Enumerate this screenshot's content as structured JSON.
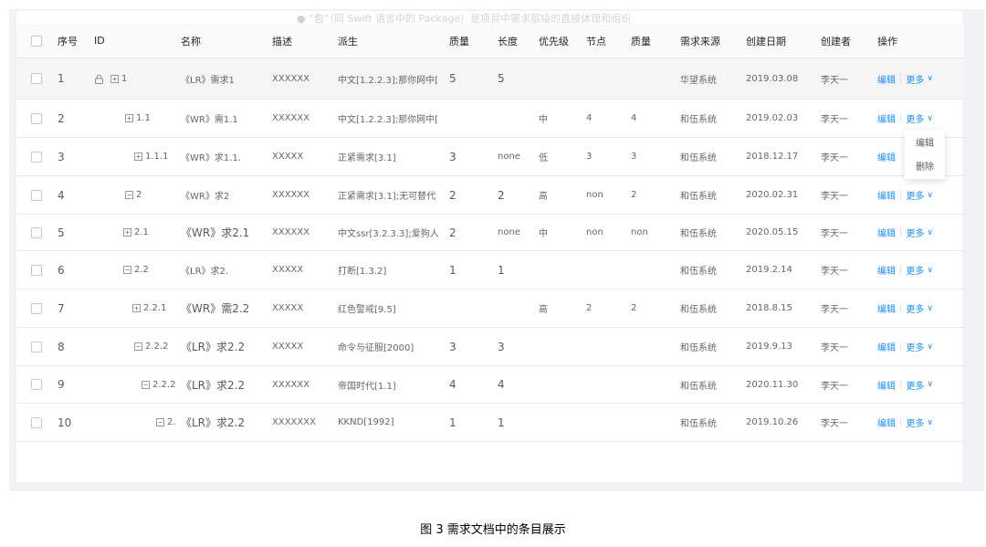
{
  "ghost_text": "● “包”（同 Swift 语言中的 Package）是项目中需求层级的直接体现和组织",
  "headers": [
    "序号",
    "ID",
    "名称",
    "描述",
    "派生",
    "质量",
    "长度",
    "优先级",
    "节点",
    "质量",
    "需求来源",
    "创建日期",
    "创建者",
    "操作"
  ],
  "rows": [
    {
      "seq": "1",
      "locked": true,
      "tree": "plus",
      "id": "1",
      "name": "《LR》需求1",
      "desc": "XXXXXX",
      "derive": "中文[1.2.2.3];那你网中[",
      "quality": "5",
      "length": "5",
      "priority": "",
      "node": "",
      "quality2": "",
      "source": "华望系统",
      "date": "2019.03.08",
      "creator": "李天一",
      "more": true
    },
    {
      "seq": "2",
      "locked": false,
      "tree": "plus",
      "id": "1.1",
      "name": "《WR》需1.1",
      "desc": "XXXXXX",
      "derive": "中文[1.2.2.3];那你网中[",
      "quality": "",
      "length": "",
      "priority": "中",
      "node": "4",
      "quality2": "4",
      "source": "和伍系统",
      "date": "2019.02.03",
      "creator": "李天一",
      "more": true
    },
    {
      "seq": "3",
      "locked": false,
      "tree": "plus",
      "id": "1.1.1",
      "name": "《WR》求1.1.",
      "desc": "XXXXX",
      "derive": "正紧需求[3.1]",
      "quality": "3",
      "length": "none",
      "priority": "低",
      "node": "3",
      "quality2": "3",
      "source": "和伍系统",
      "date": "2018.12.17",
      "creator": "李天一",
      "more": false
    },
    {
      "seq": "4",
      "locked": false,
      "tree": "minus",
      "id": "2",
      "name": "《WR》求2",
      "desc": "XXXXXX",
      "derive": "正紧需求[3.1];无可替代",
      "quality": "2",
      "length": "2",
      "priority": "高",
      "node": "non",
      "quality2": "2",
      "source": "和伍系统",
      "date": "2020.02.31",
      "creator": "李天一",
      "more": true
    },
    {
      "seq": "5",
      "locked": false,
      "tree": "plus",
      "id": "2.1",
      "name": "《WR》求2.1",
      "desc": "XXXXXX",
      "derive": "中文ssr[3.2.3.3];爱狗人",
      "quality": "2",
      "length": "none",
      "priority": "中",
      "node": "non",
      "quality2": "non",
      "source": "和伍系统",
      "date": "2020.05.15",
      "creator": "李天一",
      "more": true
    },
    {
      "seq": "6",
      "locked": false,
      "tree": "minus",
      "id": "2.2",
      "name": "《LR》求2.",
      "desc": "XXXXX",
      "derive": "打断[1.3.2]",
      "quality": "1",
      "length": "1",
      "priority": "",
      "node": "",
      "quality2": "",
      "source": "和伍系统",
      "date": "2019.2.14",
      "creator": "李天一",
      "more": true
    },
    {
      "seq": "7",
      "locked": false,
      "tree": "plus",
      "id": "2.2.1",
      "name": "《WR》需2.2",
      "desc": "XXXXX",
      "derive": "红色警戒[9.5]",
      "quality": "",
      "length": "",
      "priority": "高",
      "node": "2",
      "quality2": "2",
      "source": "和伍系统",
      "date": "2018.8.15",
      "creator": "李天一",
      "more": true
    },
    {
      "seq": "8",
      "locked": false,
      "tree": "minus",
      "id": "2.2.2",
      "name": "《LR》求2.2",
      "desc": "XXXXX",
      "derive": "命令与征服[2000]",
      "quality": "3",
      "length": "3",
      "priority": "",
      "node": "",
      "quality2": "",
      "source": "和伍系统",
      "date": "2019.9.13",
      "creator": "李天一",
      "more": true
    },
    {
      "seq": "9",
      "locked": false,
      "tree": "minus",
      "id": "2.2.2",
      "name": "《LR》求2.2",
      "desc": "XXXXXX",
      "derive": "帝国时代[1.1]",
      "quality": "4",
      "length": "4",
      "priority": "",
      "node": "",
      "quality2": "",
      "source": "和伍系统",
      "date": "2020.11.30",
      "creator": "李天一",
      "more": true
    },
    {
      "seq": "10",
      "locked": false,
      "tree": "minus",
      "id": "2.",
      "name": "《LR》求2.2",
      "desc": "XXXXXXX",
      "derive": "KKND[1992]",
      "quality": "1",
      "length": "1",
      "priority": "",
      "node": "",
      "quality2": "",
      "source": "和伍系统",
      "date": "2019.10.26",
      "creator": "李天一",
      "more": true
    }
  ],
  "actions": {
    "edit": "编辑",
    "more": "更多"
  },
  "dropdown": [
    "编辑",
    "删除"
  ],
  "caption": "图 3  需求文档中的条目展示"
}
